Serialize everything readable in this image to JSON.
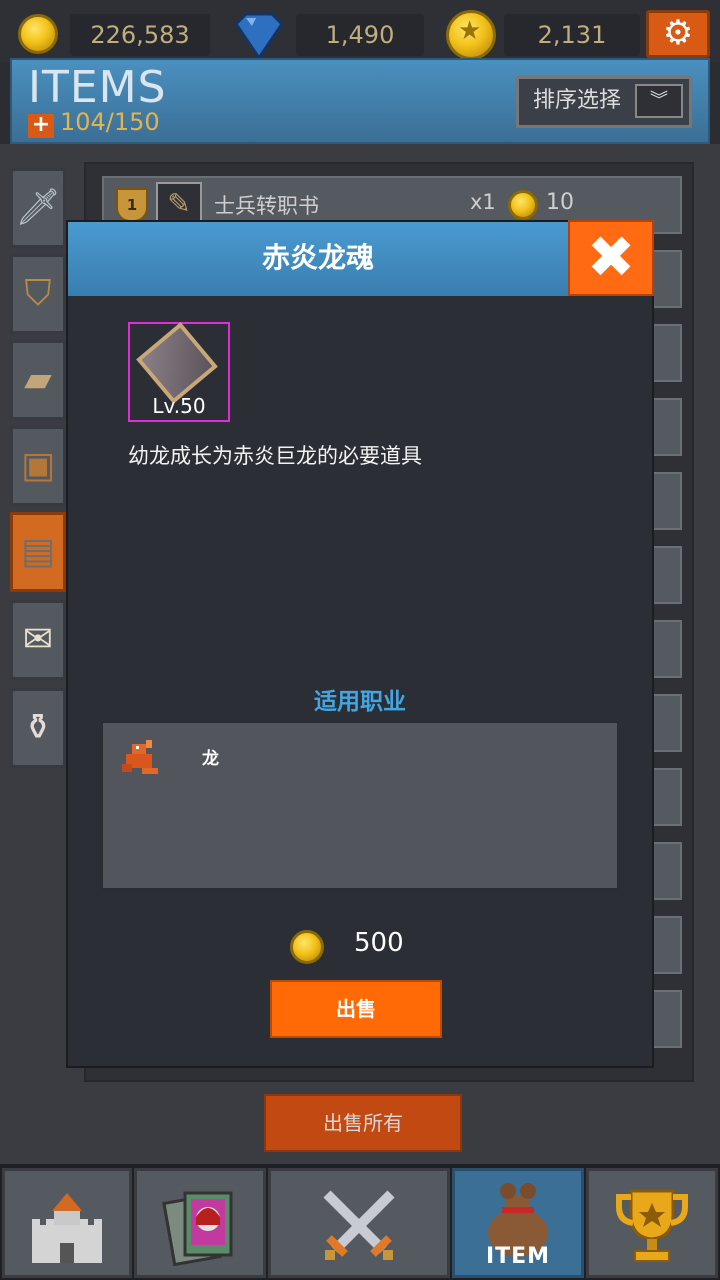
{
  "currencies": {
    "gold": "226,583",
    "gems": "1,490",
    "medals": "2,131"
  },
  "header": {
    "title": "ITEMS",
    "capacity": "104/150",
    "sort_label": "排序选择"
  },
  "list": {
    "first_item": {
      "level_badge": "1",
      "name": "士兵转职书",
      "qty": "x1",
      "price": "10"
    }
  },
  "modal": {
    "title": "赤炎龙魂",
    "item_level": "Lv.50",
    "description": "幼龙成长为赤炎巨龙的必要道具",
    "jobs_label": "适用职业",
    "job_name": "龙",
    "price": "500",
    "sell_label": "出售"
  },
  "sell_all_label": "出售所有",
  "bottom_nav": {
    "item_label": "ITEM"
  },
  "colors": {
    "accent_orange": "#ff6a13",
    "header_blue": "#4a90bf",
    "item_frame_magenta": "#e22bd9",
    "job_label_blue": "#43a6e2"
  }
}
